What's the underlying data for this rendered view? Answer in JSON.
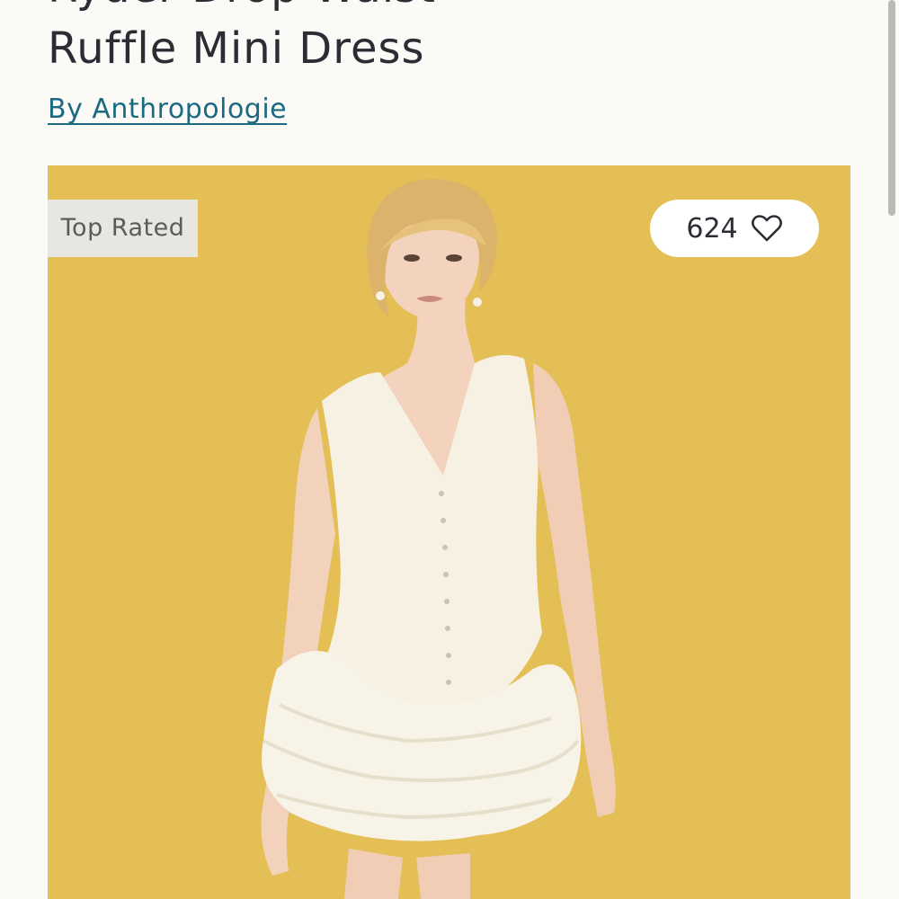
{
  "product": {
    "title_line1": "Ryder Drop-Waist",
    "title_line2": "Ruffle Mini Dress",
    "brand_link": "By Anthropologie"
  },
  "image": {
    "badge": "Top Rated",
    "favorites_count": "624",
    "heart_icon": "heart-outline-icon",
    "background_color": "#e3bf55"
  },
  "colors": {
    "link": "#1b6a82",
    "text": "#2a2d33"
  }
}
